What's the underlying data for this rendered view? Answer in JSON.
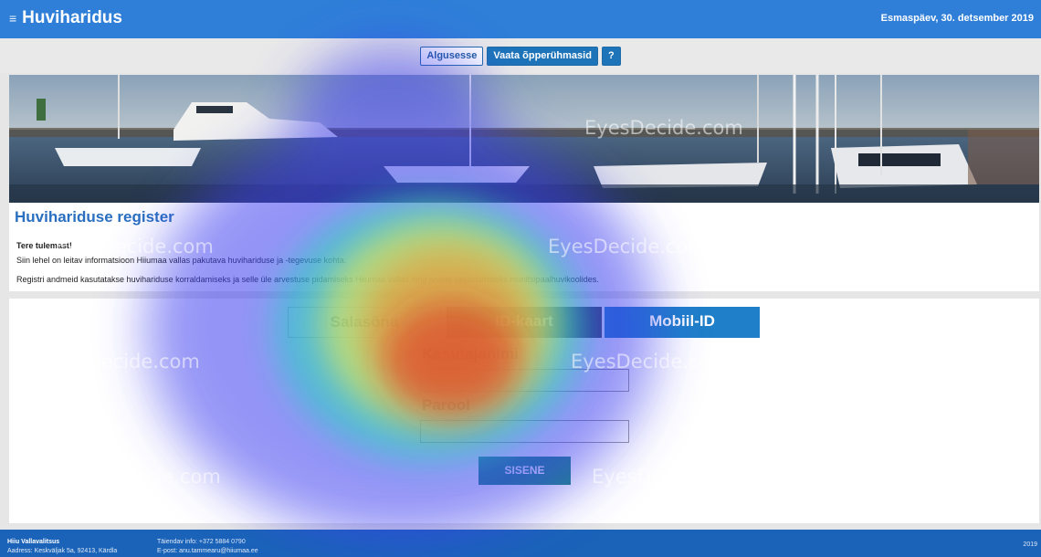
{
  "header": {
    "title": "Huviharidus",
    "date": "Esmaspäev, 30. detsember 2019"
  },
  "nav": {
    "home_label": "Algusesse",
    "groups_label": "Vaata õpperühmasid",
    "help_label": "?"
  },
  "intro": {
    "title": "Huvihariduse register",
    "greeting": "Tere tulemast!",
    "line1": "Siin lehel on leitav informatsioon Hiiumaa vallas pakutava huvihariduse ja -tegevuse kohta.",
    "line2": "Registri andmeid kasutatakse huvihariduse korraldamiseks ja selle üle arvestuse pidamiseks Hiiumaa vallas ning arvete väljastamiseks munitsipaalhuvikoolides."
  },
  "login": {
    "tabs": [
      "Salasõna",
      "ID-kaart",
      "Mobiil-ID"
    ],
    "username_label": "Kasutajanimi",
    "password_label": "Parool",
    "username_value": "",
    "password_value": "",
    "submit_label": "SISENE"
  },
  "footer": {
    "org": "Hiiu Vallavalitsus",
    "address": "Aadress: Keskväljak 5a, 92413, Kärdla",
    "phone": "Täiendav info: +372 5884 0790",
    "email": "E-post: anu.tammearu@hiiumaa.ee",
    "year": "2019"
  },
  "watermark": "EyesDecide.com",
  "colors": {
    "header": "#2f7fd8",
    "accent_button": "#1d74b8",
    "id_tab": "#2f3a4a",
    "mobile_tab": "#1f7fc8",
    "submit": "#1e8b82",
    "footer": "#1a63b8"
  },
  "icons": {
    "menu": "hamburger-icon"
  }
}
